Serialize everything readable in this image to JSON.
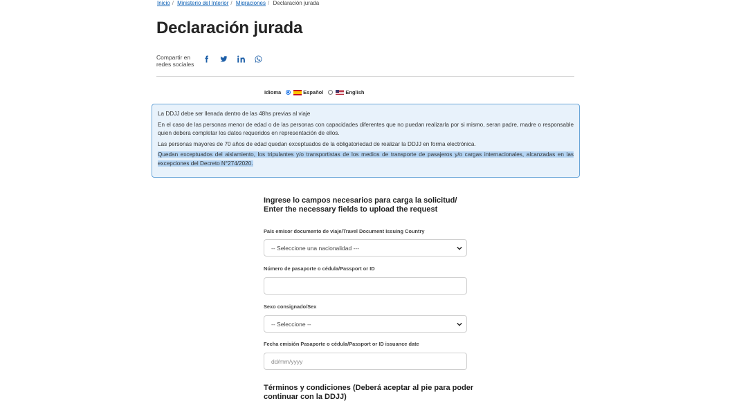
{
  "breadcrumb": {
    "items": [
      "Inicio",
      "Ministerio del Interior",
      "Migraciones"
    ],
    "current": "Declaración jurada"
  },
  "page_title": "Declaración jurada",
  "share": {
    "label_line1": "Compartir en",
    "label_line2": "redes sociales",
    "icons": [
      "facebook-icon",
      "twitter-icon",
      "linkedin-icon",
      "whatsapp-icon"
    ]
  },
  "language": {
    "label": "Idioma",
    "options": [
      {
        "label": "Español",
        "selected": true
      },
      {
        "label": "English",
        "selected": false
      }
    ]
  },
  "info": {
    "line1": "La DDJJ debe ser llenada dentro de las 48hs previas al viaje",
    "line2": "En el caso de las personas menor de edad o de las personas con capacidades diferentes que no puedan realizarla por si mismo, seran padre, madre o responsable quien debera completar los datos requeridos en representación de ellos.",
    "line3": "Las personas mayores de 70 años de edad quedan exceptuados de la obligatoriedad de realizar la DDJJ en forma electrónica.",
    "line4": "Quedan exceptuados del aislamiento, los tripulantes y/o transportistas de los medios de transporte de pasajeros y/o cargas internacionales, alcanzadas en las excepciones del Decreto N°274/2020."
  },
  "form": {
    "title_line1": "Ingrese lo campos necesarios para carga la solicitud/",
    "title_line2": "Enter the necessary fields to upload the request",
    "country_label": "País emisor documento de viaje/Travel Document Issuing Country",
    "country_value": "-- Seleccione una nacionalidad ---",
    "passport_label": "Número de pasaporte o cédula/Passport or ID",
    "passport_value": "",
    "sex_label": "Sexo consignado/Sex",
    "sex_value": "-- Seleccione --",
    "date_label": "Fecha emisión Pasaporte o cédula/Passport or ID issuance date",
    "date_placeholder": "dd/mm/yyyy"
  },
  "terms": {
    "line1": "Términos y condiciones (Deberá aceptar al pie para poder",
    "line2": "continuar con la DDJJ)"
  },
  "colors": {
    "link": "#0b5fb4",
    "info_border": "#6aa6d8",
    "info_bg": "#e8f2fb",
    "highlight": "#b4d4f3",
    "icon": "#1d5fa8"
  }
}
